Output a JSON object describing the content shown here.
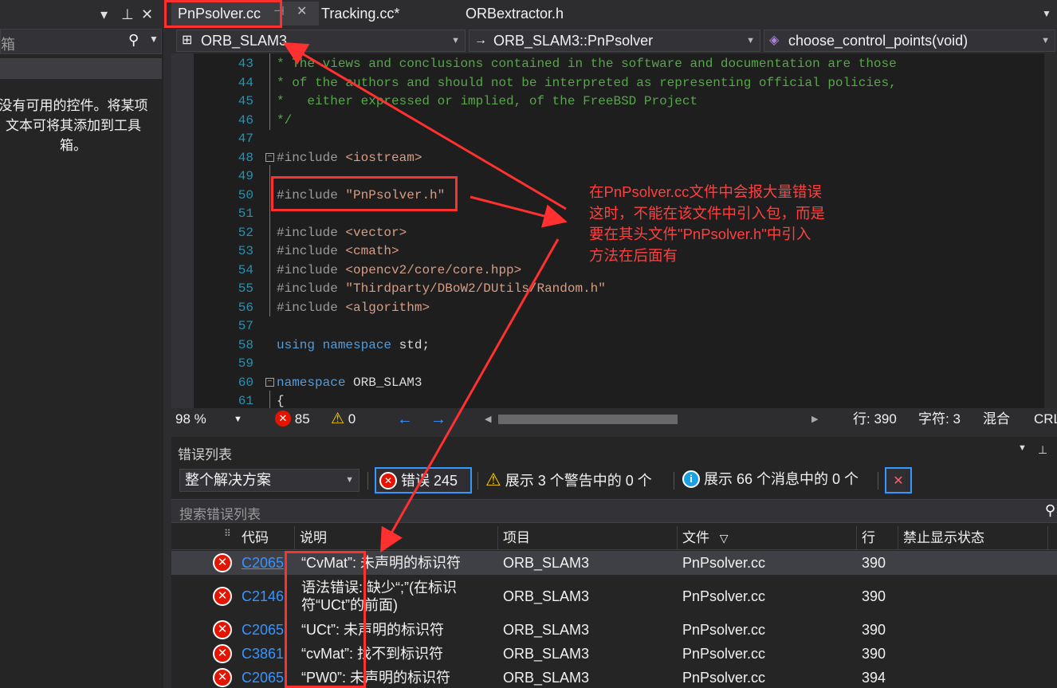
{
  "toolbox": {
    "search_text": "箱",
    "message_lines": [
      "没有可用的控件。将某项",
      "文本可将其添加到工具",
      "箱。"
    ]
  },
  "tabs": [
    {
      "label": "PnPsolver.cc",
      "active": true
    },
    {
      "label": "Tracking.cc*",
      "active": false
    },
    {
      "label": "ORBextractor.h",
      "active": false
    }
  ],
  "navbar": {
    "project": "ORB_SLAM3",
    "scope": "ORB_SLAM3::PnPsolver",
    "member": "choose_control_points(void)"
  },
  "code": [
    {
      "n": "43",
      "text": "* The views and conclusions contained in the software and documentation are those",
      "kind": "cmt"
    },
    {
      "n": "44",
      "text": "* of the authors and should not be interpreted as representing official policies,",
      "kind": "cmt"
    },
    {
      "n": "45",
      "text": "*   either expressed or implied, of the FreeBSD Project",
      "kind": "cmt"
    },
    {
      "n": "46",
      "text": "*/",
      "kind": "cmt"
    },
    {
      "n": "47",
      "text": "",
      "kind": "plain"
    },
    {
      "n": "48",
      "pre": "#include ",
      "arg": "<iostream>",
      "kind": "inc",
      "fold": true
    },
    {
      "n": "49",
      "text": "",
      "kind": "plain"
    },
    {
      "n": "50",
      "pre": "#include ",
      "arg": "\"PnPsolver.h\"",
      "kind": "inc"
    },
    {
      "n": "51",
      "text": "",
      "kind": "plain"
    },
    {
      "n": "52",
      "pre": "#include ",
      "arg": "<vector>",
      "kind": "inc"
    },
    {
      "n": "53",
      "pre": "#include ",
      "arg": "<cmath>",
      "kind": "inc"
    },
    {
      "n": "54",
      "pre": "#include ",
      "arg": "<opencv2/core/core.hpp>",
      "kind": "inc"
    },
    {
      "n": "55",
      "pre": "#include ",
      "arg": "\"Thirdparty/DBoW2/DUtils/Random.h\"",
      "kind": "inc"
    },
    {
      "n": "56",
      "pre": "#include ",
      "arg": "<algorithm>",
      "kind": "inc"
    },
    {
      "n": "57",
      "text": "",
      "kind": "plain"
    },
    {
      "n": "58",
      "kw": "using namespace",
      "rest": " std;",
      "kind": "kwline"
    },
    {
      "n": "59",
      "text": "",
      "kind": "plain"
    },
    {
      "n": "60",
      "kw": "namespace",
      "rest": " ORB_SLAM3",
      "kind": "kwline",
      "fold": true
    },
    {
      "n": "61",
      "text": "{",
      "kind": "plain"
    }
  ],
  "editor_status": {
    "zoom": "98 %",
    "errors": "85",
    "warnings": "0",
    "line": "行: 390",
    "char": "字符: 3",
    "mode": "混合",
    "eol": "CRL"
  },
  "errlist": {
    "title": "错误列表",
    "scope": "整个解决方案",
    "errors_btn": "错误 245",
    "warnings_btn": "展示 3 个警告中的 0 个",
    "messages_btn": "展示 66 个消息中的 0 个",
    "search_placeholder": "搜索错误列表",
    "columns": [
      "代码",
      "说明",
      "项目",
      "文件",
      "行",
      "禁止显示状态"
    ],
    "rows": [
      {
        "code": "C2065",
        "desc1": "“CvMat”: 未声明的标识符",
        "desc2": "",
        "project": "ORB_SLAM3",
        "file": "PnPsolver.cc",
        "line": "390"
      },
      {
        "code": "C2146",
        "desc1": "语法错误: 缺少“;”(在标识",
        "desc2": "符“UCt”的前面)",
        "project": "ORB_SLAM3",
        "file": "PnPsolver.cc",
        "line": "390"
      },
      {
        "code": "C2065",
        "desc1": "“UCt”: 未声明的标识符",
        "desc2": "",
        "project": "ORB_SLAM3",
        "file": "PnPsolver.cc",
        "line": "390"
      },
      {
        "code": "C3861",
        "desc1": "“cvMat”: 找不到标识符",
        "desc2": "",
        "project": "ORB_SLAM3",
        "file": "PnPsolver.cc",
        "line": "390"
      },
      {
        "code": "C2065",
        "desc1": "“PW0”: 未声明的标识符",
        "desc2": "",
        "project": "ORB_SLAM3",
        "file": "PnPsolver.cc",
        "line": "394"
      }
    ]
  },
  "annotation": {
    "lines": [
      "在PnPsolver.cc文件中会报大量错误",
      "这时，不能在该文件中引入包，而是",
      "要在其头文件\"PnPsolver.h\"中引入",
      "方法在后面有"
    ],
    "color": "#ff3030"
  },
  "colors": {
    "comment": "#57a64a",
    "keyword": "#569cd6",
    "string": "#d69d85",
    "line_number": "#2b91af",
    "error": "#e51400",
    "warning": "#ffcc00",
    "info": "#1ba1e2",
    "link": "#3794ff"
  }
}
